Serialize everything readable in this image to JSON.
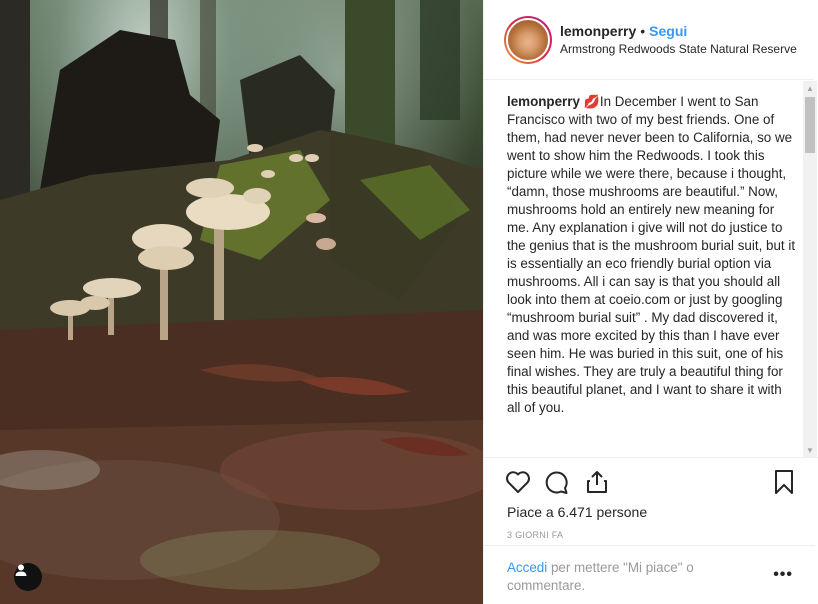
{
  "post": {
    "username": "lemonperry",
    "separator": "•",
    "follow_label": "Segui",
    "location": "Armstrong Redwoods State Natural Reserve"
  },
  "caption": {
    "username": "lemonperry",
    "emoji": "💋",
    "text": "In December I went to San Francisco with two of my best friends. One of them, had never never been to California, so we went to show him the Redwoods. I took this picture while we were there, because i thought, “damn, those mushrooms are beautiful.” Now, mushrooms hold an entirely new meaning for me. Any explanation i give will not do justice to the genius that is the mushroom burial suit, but it is essentially an eco friendly burial option via mushrooms. All i can say is that you should all look into them at coeio.com or just by googling “mushroom burial suit” . My dad discovered it, and was more excited by this than I have ever seen him. He was buried in this suit, one of his final wishes. They are truly a beautiful thing for this beautiful planet, and I want to share it with all of you."
  },
  "icons": {
    "like": "heart-icon",
    "comment": "comment-icon",
    "share": "share-icon",
    "save": "bookmark-icon",
    "user_tag": "user-icon"
  },
  "likes": {
    "label": "Piace a 6.471 persone"
  },
  "time": {
    "label": "3 GIORNI FA"
  },
  "comment_bar": {
    "login_label": "Accedi",
    "rest_label": "per mettere \"Mi piace\" o commentare.",
    "more_label": "•••"
  }
}
